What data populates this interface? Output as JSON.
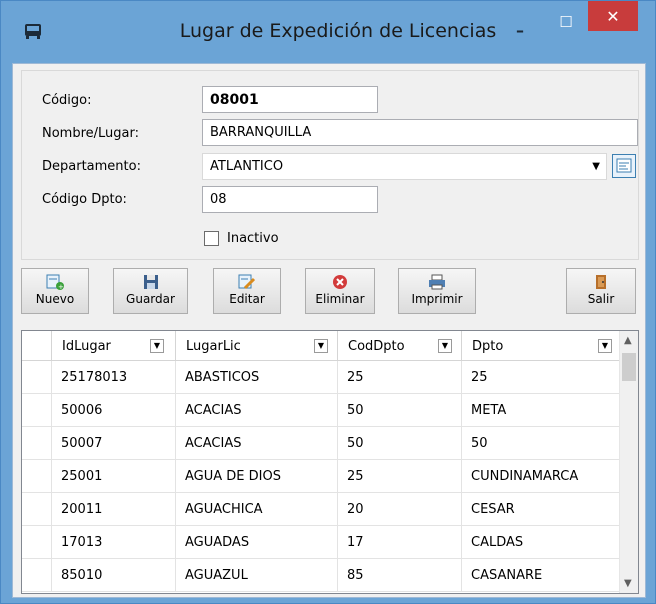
{
  "window": {
    "title": "Lugar de Expedición de Licencias",
    "minimize": "–",
    "maximize": "☐",
    "close": "✕"
  },
  "form": {
    "codigo_label": "Código:",
    "codigo_value": "08001",
    "nombre_label": "Nombre/Lugar:",
    "nombre_value": "BARRANQUILLA",
    "departamento_label": "Departamento:",
    "departamento_value": "ATLANTICO",
    "codigo_dpto_label": "Código Dpto:",
    "codigo_dpto_value": "08",
    "inactivo_label": "Inactivo",
    "inactivo_checked": false
  },
  "toolbar": {
    "nuevo": "Nuevo",
    "guardar": "Guardar",
    "editar": "Editar",
    "eliminar": "Eliminar",
    "imprimir": "Imprimir",
    "salir": "Salir"
  },
  "grid": {
    "columns": [
      "IdLugar",
      "LugarLic",
      "CodDpto",
      "Dpto"
    ],
    "rows": [
      [
        "25178013",
        "ABASTICOS",
        "25",
        "25"
      ],
      [
        "50006",
        "ACACIAS",
        "50",
        "META"
      ],
      [
        "50007",
        "ACACIAS",
        "50",
        "50"
      ],
      [
        "25001",
        "AGUA DE DIOS",
        "25",
        "CUNDINAMARCA"
      ],
      [
        "20011",
        "AGUACHICA",
        "20",
        "CESAR"
      ],
      [
        "17013",
        "AGUADAS",
        "17",
        "CALDAS"
      ],
      [
        "85010",
        "AGUAZUL",
        "85",
        "CASANARE"
      ]
    ]
  },
  "colors": {
    "titlebar": "#6ba4d6",
    "close": "#c83c3c",
    "client": "#f0f0f0"
  }
}
